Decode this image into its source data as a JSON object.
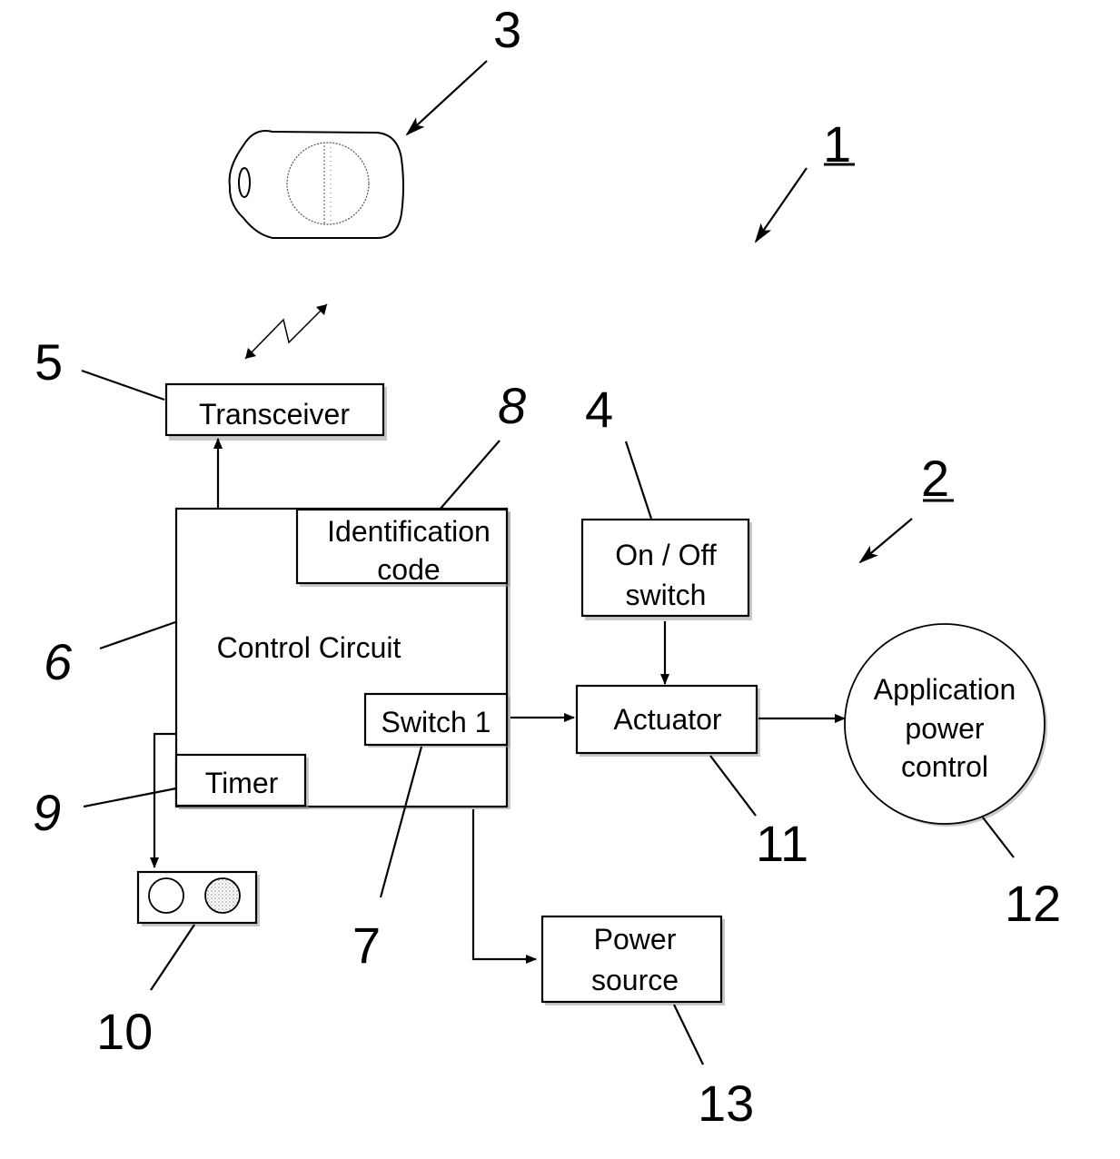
{
  "figure": {
    "system_ref": "1",
    "device_ref": "2"
  },
  "components": {
    "key_fob": {
      "ref": "3",
      "icon": "key-fob-icon"
    },
    "on_off_switch": {
      "ref": "4",
      "line1": "On / Off",
      "line2": "switch"
    },
    "transceiver": {
      "ref": "5",
      "label": "Transceiver"
    },
    "control_circuit": {
      "ref": "6",
      "label": "Control Circuit"
    },
    "switch1": {
      "ref": "7",
      "label": "Switch 1"
    },
    "identification_code": {
      "ref": "8",
      "line1": "Identification",
      "line2": "code"
    },
    "timer": {
      "ref": "9",
      "label": "Timer"
    },
    "indicator_lights": {
      "ref": "10",
      "icon": "indicator-lights-icon"
    },
    "actuator": {
      "ref": "11",
      "label": "Actuator"
    },
    "application_power_control": {
      "ref": "12",
      "line1": "Application",
      "line2": "power",
      "line3": "control"
    },
    "power_source": {
      "ref": "13",
      "line1": "Power",
      "line2": "source"
    }
  },
  "wireless_link": {
    "icon": "wireless-link-icon"
  }
}
